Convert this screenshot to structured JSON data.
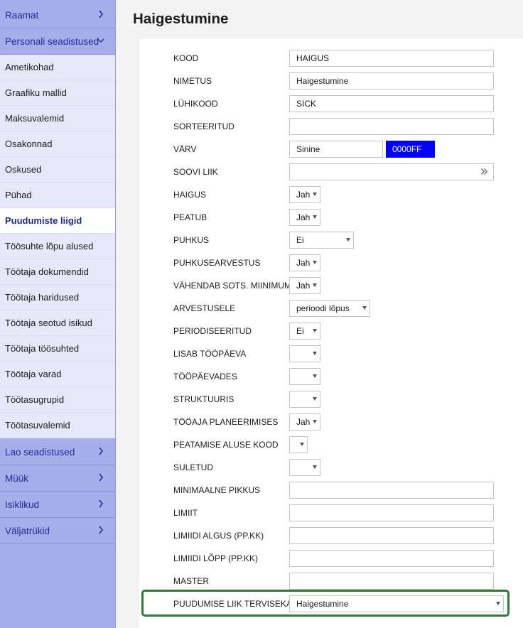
{
  "sidebar": {
    "top_groups": [
      {
        "label": "Raamat",
        "chevron": "chevron-right-icon"
      },
      {
        "label": "Personali seadistused",
        "chevron": "chevron-down-icon"
      }
    ],
    "items": [
      {
        "label": "Ametikohad"
      },
      {
        "label": "Graafiku mallid"
      },
      {
        "label": "Maksuvalemid"
      },
      {
        "label": "Osakonnad"
      },
      {
        "label": "Oskused"
      },
      {
        "label": "Pühad"
      },
      {
        "label": "Puudumiste liigid",
        "active": true
      },
      {
        "label": "Töösuhte lõpu alused"
      },
      {
        "label": "Töötaja dokumendid"
      },
      {
        "label": "Töötaja haridused"
      },
      {
        "label": "Töötaja seotud isikud"
      },
      {
        "label": "Töötaja töösuhted"
      },
      {
        "label": "Töötaja varad"
      },
      {
        "label": "Töötasugrupid"
      },
      {
        "label": "Töötasuvalemid"
      }
    ],
    "bottom_groups": [
      {
        "label": "Lao seadistused",
        "chevron": "chevron-right-icon"
      },
      {
        "label": "Müük",
        "chevron": "chevron-right-icon"
      },
      {
        "label": "Isiklikud",
        "chevron": "chevron-right-icon"
      },
      {
        "label": "Väljatrükid",
        "chevron": "chevron-right-icon"
      }
    ]
  },
  "page": {
    "title": "Haigestumine"
  },
  "form": {
    "kood": {
      "label": "KOOD",
      "value": "HAIGUS"
    },
    "nimetus": {
      "label": "NIMETUS",
      "value": "Haigestumine"
    },
    "luhikood": {
      "label": "LÜHIKOOD",
      "value": "SICK"
    },
    "sorteeritud": {
      "label": "SORTEERITUD",
      "value": ""
    },
    "varv": {
      "label": "VÄRV",
      "value": "Sinine",
      "hex_label": "0000FF",
      "swatch_color": "#0000FF"
    },
    "soovi_liik": {
      "label": "SOOVI LIIK",
      "value": "",
      "icon": "double-chevron-right-icon"
    },
    "haigus": {
      "label": "HAIGUS",
      "value": "Jah"
    },
    "peatub": {
      "label": "PEATUB",
      "value": "Jah"
    },
    "puhkus": {
      "label": "PUHKUS",
      "value": "Ei"
    },
    "puhkusearvestus": {
      "label": "PUHKUSEARVESTUS",
      "value": "Jah"
    },
    "vahendab": {
      "label": "VÄHENDAB SOTS. MIINIMUMI",
      "value": "Jah"
    },
    "arvestusele": {
      "label": "ARVESTUSELE",
      "value": "perioodi lõpus"
    },
    "periodiseeritud": {
      "label": "PERIODISEERITUD",
      "value": "Ei"
    },
    "lisab": {
      "label": "LISAB TÖÖPÄEVA",
      "value": ""
    },
    "toopaevades": {
      "label": "TÖÖPÄEVADES",
      "value": ""
    },
    "struktuuris": {
      "label": "STRUKTUURIS",
      "value": ""
    },
    "tooaja": {
      "label": "TÖÖAJA PLANEERIMISES",
      "value": "Jah"
    },
    "peatamise": {
      "label": "PEATAMISE ALUSE KOOD",
      "value": ""
    },
    "suletud": {
      "label": "SULETUD",
      "value": ""
    },
    "min_pikkus": {
      "label": "MINIMAALNE PIKKUS",
      "value": ""
    },
    "limiit": {
      "label": "LIMIIT",
      "value": ""
    },
    "limiidi_algus": {
      "label": "LIMIIDI ALGUS (PP.KK)",
      "value": ""
    },
    "limiidi_lopp": {
      "label": "LIMIIDI LÕPP (PP.KK)",
      "value": ""
    },
    "master": {
      "label": "MASTER",
      "value": ""
    },
    "tervisekassa": {
      "label": "PUUDUMISE LIIK TERVISEKASSAS",
      "value": "Haigestumine"
    }
  },
  "colors": {
    "sidebar_bg": "#a8aeea",
    "accent_text": "#24299a",
    "highlight_border": "#2e7d32"
  }
}
